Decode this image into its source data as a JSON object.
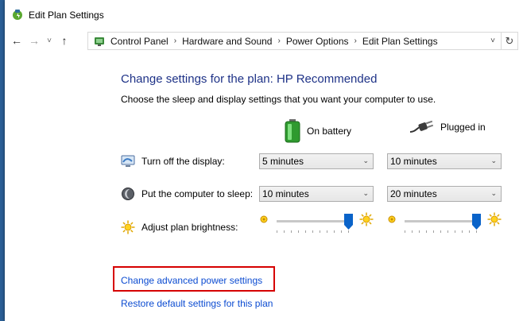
{
  "window": {
    "title": "Edit Plan Settings"
  },
  "nav": {
    "back": "←",
    "forward": "→",
    "recent": "˅",
    "up": "↑"
  },
  "address": {
    "crumbs": [
      "Control Panel",
      "Hardware and Sound",
      "Power Options",
      "Edit Plan Settings"
    ],
    "separator": "›",
    "dropdown": "˅",
    "refresh": "↻"
  },
  "main": {
    "heading": "Change settings for the plan: HP Recommended",
    "subheading": "Choose the sleep and display settings that you want your computer to use.",
    "columns": {
      "battery": "On battery",
      "plugged": "Plugged in"
    },
    "rows": {
      "display": {
        "label": "Turn off the display:",
        "battery": "5 minutes",
        "plugged": "10 minutes"
      },
      "sleep": {
        "label": "Put the computer to sleep:",
        "battery": "10 minutes",
        "plugged": "20 minutes"
      },
      "brightness": {
        "label": "Adjust plan brightness:",
        "battery_level": 1.0,
        "plugged_level": 1.0
      }
    },
    "links": {
      "advanced": "Change advanced power settings",
      "restore": "Restore default settings for this plan"
    }
  },
  "colors": {
    "heading": "#1e3287",
    "link": "#0b4bd1",
    "highlight": "#d60000",
    "slider_thumb": "#0a63c9",
    "desktop": "#2a5f95"
  },
  "icons": {
    "app": "power-plan-icon",
    "control_panel": "control-panel-icon",
    "battery": "battery-icon",
    "plug": "power-plug-icon",
    "display": "monitor-icon",
    "sleep": "moon-icon",
    "brightness": "sun-icon"
  }
}
